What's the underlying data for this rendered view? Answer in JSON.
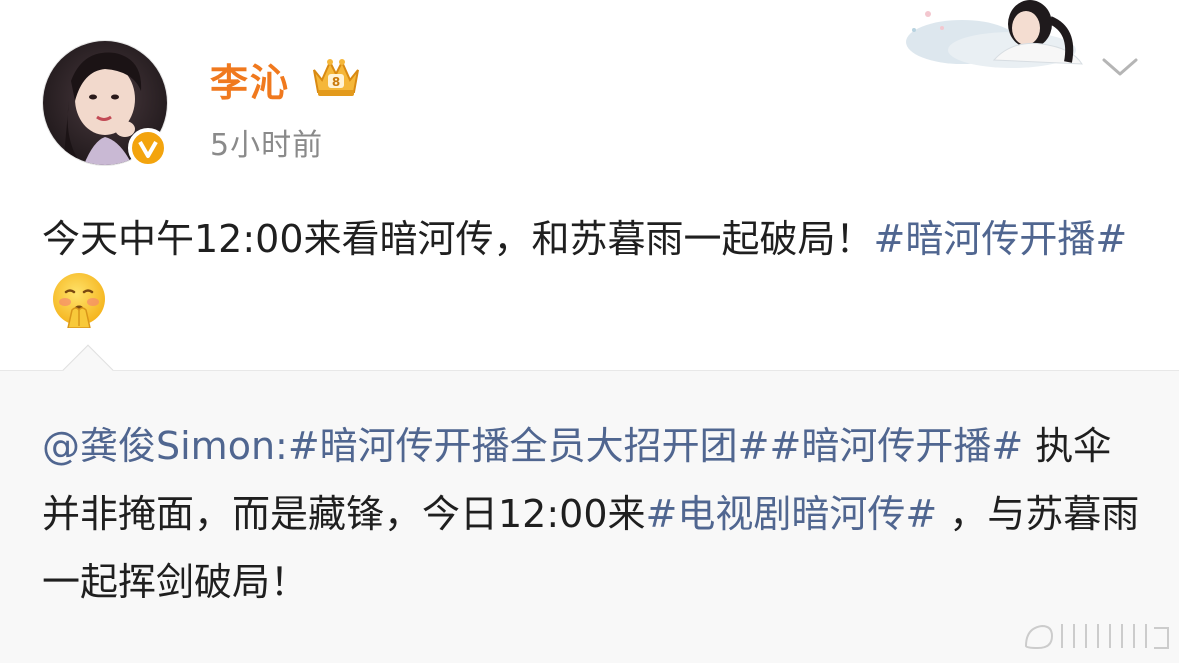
{
  "post": {
    "author": "李沁",
    "time": "5小时前",
    "text_before_topic": "今天中午12:00来看暗河传，和苏暮雨一起破局！",
    "topic_1": "#暗河传开播#",
    "emoji": "shushing-face-emoji"
  },
  "repost": {
    "mention": "@龚俊Simon",
    "colon": ":",
    "topic_1": "#暗河传开播全员大招开团#",
    "topic_2": "#暗河传开播#",
    "text_1": " 执伞并非掩面，而是藏锋，今日12:00来",
    "topic_3": "#电视剧暗河传#",
    "text_2": " ，与苏暮雨一起挥剑破局！"
  },
  "colors": {
    "name_orange": "#f0791e",
    "link_blue": "#506690",
    "verified_gold": "#f3a40e",
    "repost_bg": "#f8f8f8"
  },
  "icons": {
    "verified": "verified-v-icon",
    "member": "crown-member-badge-icon",
    "more": "chevron-down-icon",
    "watermark": "weibo-watermark-icon"
  }
}
